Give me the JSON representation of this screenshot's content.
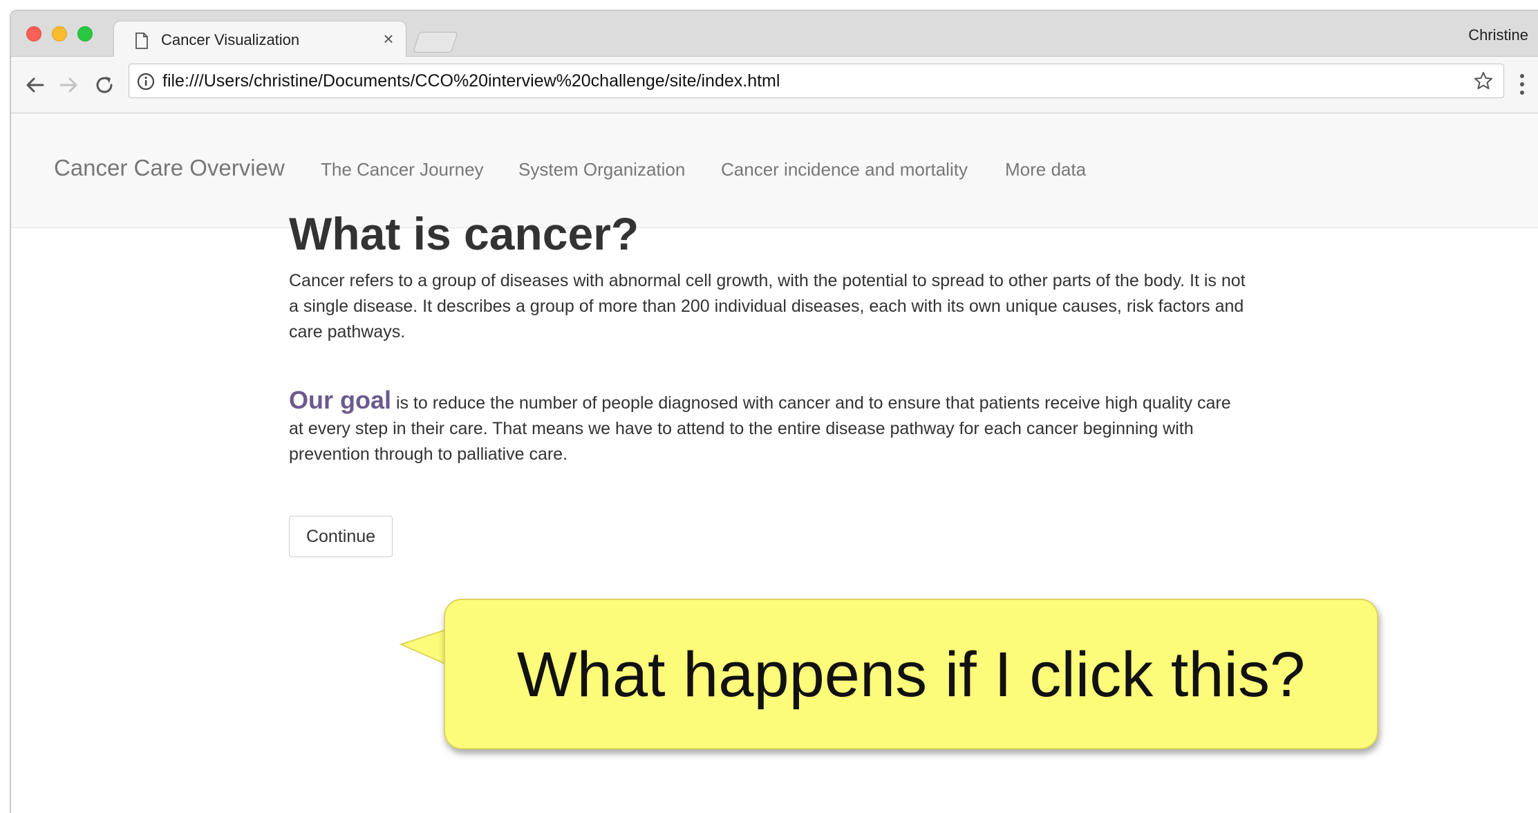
{
  "browser": {
    "tab_title": "Cancer Visualization",
    "profile_name": "Christine",
    "url": "file:///Users/christine/Documents/CCO%20interview%20challenge/site/index.html",
    "icons": [
      "page-icon",
      "close-icon",
      "back-arrow-icon",
      "forward-arrow-icon",
      "reload-icon",
      "info-icon",
      "star-icon",
      "more-vert-icon"
    ]
  },
  "site_nav": {
    "brand": "Cancer Care Overview",
    "links": [
      "The Cancer Journey",
      "System Organization",
      "Cancer incidence and mortality",
      "More data"
    ]
  },
  "main": {
    "heading": "What is cancer?",
    "intro": "Cancer refers to a group of diseases with abnormal cell growth, with the potential to spread to other parts of the body. It is not a single disease. It describes a group of more than 200 individual diseases, each with its own unique causes, risk factors and care pathways.",
    "goal_label": "Our goal",
    "goal_text": " is to reduce the number of people diagnosed with cancer and to ensure that patients receive high quality care at every step in their care. That means we have to attend to the entire disease pathway for each cancer beginning with prevention through to palliative care.",
    "continue_label": "Continue"
  },
  "annotation": {
    "text": "What happens if I click this?"
  },
  "colors": {
    "goal_accent": "#6b5a8e",
    "callout_fill": "#fdfb7a",
    "nav_text": "#777777",
    "body_text": "#333333"
  }
}
